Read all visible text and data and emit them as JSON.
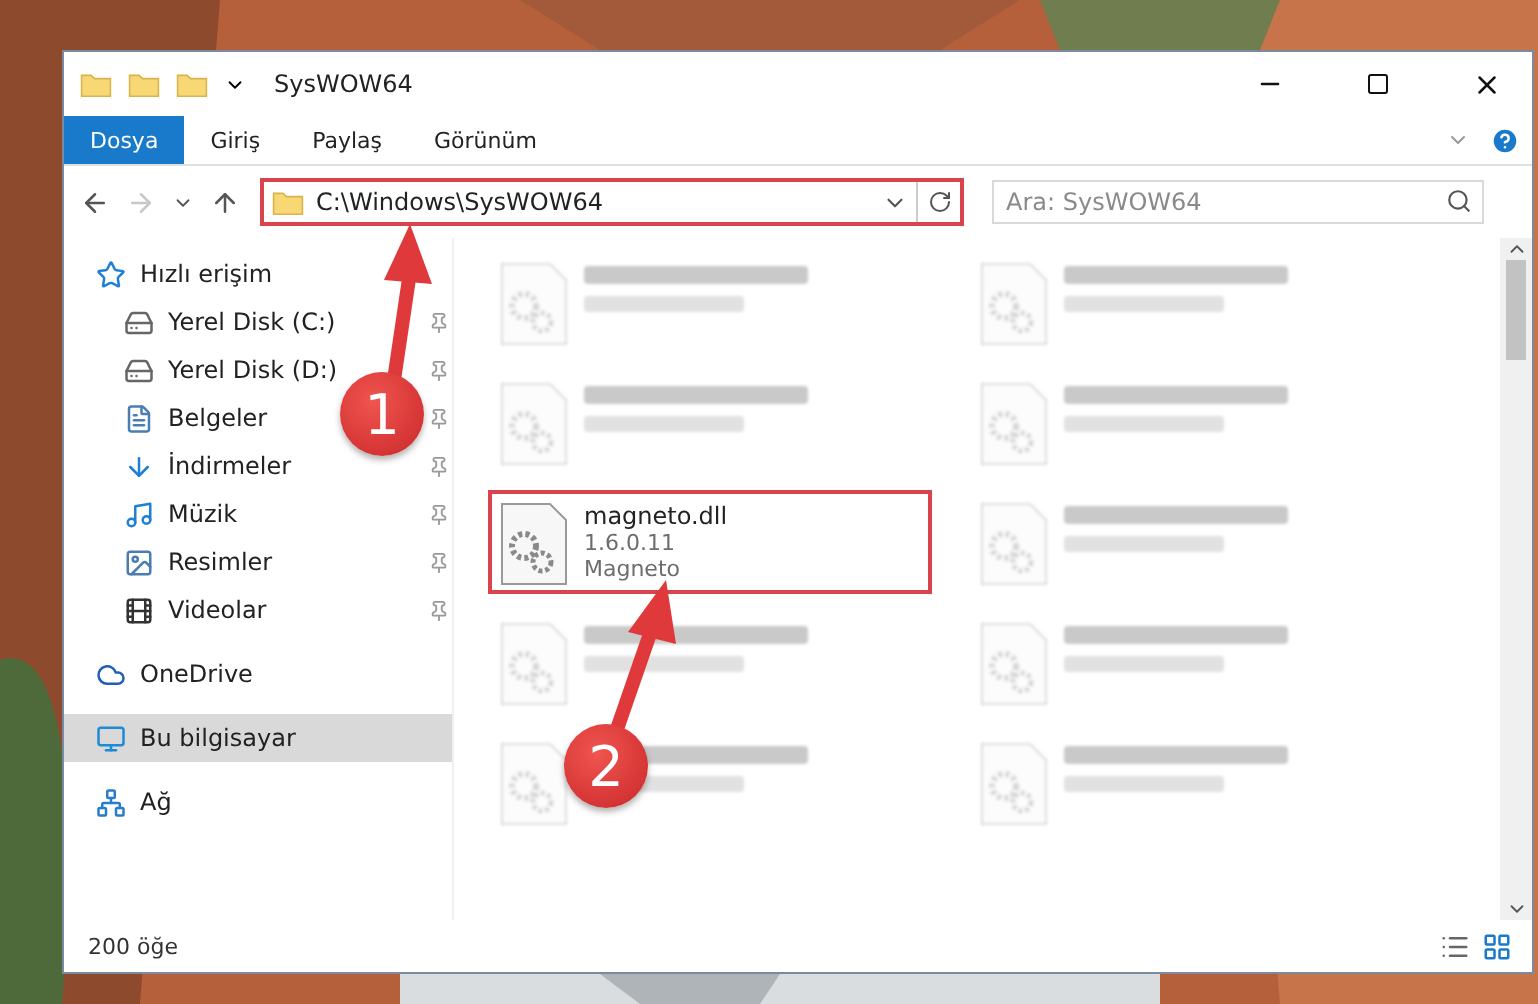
{
  "window": {
    "title": "SysWOW64"
  },
  "ribbon": {
    "tabs": [
      {
        "label": "Dosya",
        "selected": true
      },
      {
        "label": "Giriş",
        "selected": false
      },
      {
        "label": "Paylaş",
        "selected": false
      },
      {
        "label": "Görünüm",
        "selected": false
      }
    ]
  },
  "address": {
    "path": "C:\\Windows\\SysWOW64",
    "highlighted": true
  },
  "search": {
    "placeholder": "Ara: SysWOW64"
  },
  "sidebar": {
    "items": [
      {
        "label": "Hızlı erişim",
        "selected": false,
        "children": [
          {
            "label": "Yerel Disk (C:)",
            "pinned": true,
            "selected": false
          },
          {
            "label": "Yerel Disk (D:)",
            "pinned": true,
            "selected": false
          },
          {
            "label": "Belgeler",
            "pinned": true,
            "selected": false
          },
          {
            "label": "İndirmeler",
            "pinned": true,
            "selected": false
          },
          {
            "label": "Müzik",
            "pinned": true,
            "selected": false
          },
          {
            "label": "Resimler",
            "pinned": true,
            "selected": false
          },
          {
            "label": "Videolar",
            "pinned": true,
            "selected": false
          }
        ]
      },
      {
        "label": "OneDrive",
        "selected": false
      },
      {
        "label": "Bu bilgisayar",
        "selected": true
      },
      {
        "label": "Ağ",
        "selected": false
      }
    ]
  },
  "files": [
    {
      "kind": "blurred"
    },
    {
      "kind": "blurred"
    },
    {
      "kind": "blurred"
    },
    {
      "kind": "blurred"
    },
    {
      "kind": "file",
      "name": "magneto.dll",
      "lines": [
        "1.6.0.11",
        "Magneto"
      ],
      "highlighted": true
    },
    {
      "kind": "blurred"
    },
    {
      "kind": "blurred"
    },
    {
      "kind": "blurred"
    },
    {
      "kind": "blurred"
    },
    {
      "kind": "blurred"
    }
  ],
  "status_bar": {
    "count": "200 öğe"
  },
  "annotations": [
    {
      "label": "1"
    },
    {
      "label": "2"
    }
  ]
}
